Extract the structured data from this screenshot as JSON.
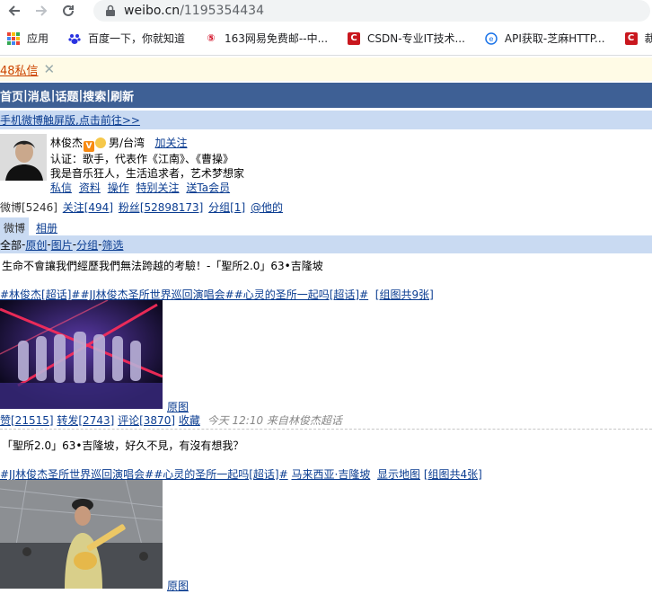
{
  "browser": {
    "url_host": "weibo.cn",
    "url_path": "/1195354434",
    "bookmarks": [
      {
        "icon": "apps-grid-icon",
        "label": "应用"
      },
      {
        "icon": "baidu-paw-icon",
        "label": "百度一下，你就知道"
      },
      {
        "icon": "netease-163-icon",
        "label": "163网易免费邮--中..."
      },
      {
        "icon": "csdn-icon",
        "label": "CSDN-专业IT技术..."
      },
      {
        "icon": "api-icon",
        "label": "API获取-芝麻HTTP..."
      },
      {
        "icon": "csdn-icon",
        "label": "裁判"
      }
    ]
  },
  "notice": {
    "messages": "48私信",
    "close": "✕"
  },
  "nav": {
    "items": [
      "首页",
      "消息",
      "话题",
      "搜索",
      "刷新"
    ]
  },
  "touch_link": "手机微博触屏版,点击前往>>",
  "profile": {
    "name": "林俊杰",
    "gender_location": "男/台湾",
    "follow": "加关注",
    "verify": "认证：歌手，代表作《江南》、《曹操》",
    "bio": "我是音乐狂人，生活追求者，艺术梦想家",
    "links": [
      "私信",
      "资料",
      "操作",
      "特别关注",
      "送Ta会员"
    ]
  },
  "stats": {
    "weibo": "微博[5246]",
    "follows": "关注[494]",
    "fans": "粉丝[52898173]",
    "group": "分组[1]",
    "at": "@他的"
  },
  "tabs": {
    "active": "微博",
    "other": "相册"
  },
  "filter": {
    "all": "全部",
    "items": [
      "原创",
      "图片",
      "分组",
      "筛选"
    ]
  },
  "posts": [
    {
      "text": "生命不會讓我們經歷我們無法跨越的考驗！-「聖所2.0」63•吉隆坡",
      "tags": "#林俊杰[超话]##JJ林俊杰圣所世界巡回演唱会##心灵的圣所一起吗[超话]#",
      "group_images": "[组图共9张]",
      "orig": "原图",
      "likes": "赞[21515]",
      "reposts": "转发[2743]",
      "comments": "评论[3870]",
      "collect": "收藏",
      "time": "今天 12:10 来自林俊杰超话"
    },
    {
      "text": "「聖所2.0」63•吉隆坡，好久不見，有沒有想我？",
      "tags": "#JJ林俊杰圣所世界巡回演唱会##心灵的圣所一起吗[超话]#",
      "location": "马来西亚·吉隆坡",
      "map": "显示地图",
      "group_images": "[组图共4张]",
      "orig": "原图"
    }
  ]
}
